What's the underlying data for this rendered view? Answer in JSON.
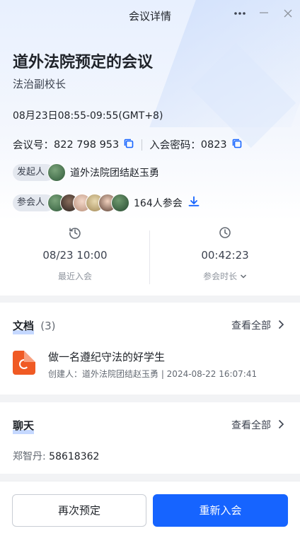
{
  "window": {
    "title": "会议详情"
  },
  "meeting": {
    "title": "道外法院预定的会议",
    "subtitle": "法治副校长",
    "time": "08月23日08:55-09:55(GMT+8)",
    "id_label": "会议号：",
    "id_value": "822 798 953",
    "password_label": "入会密码：",
    "password_value": "0823",
    "organizer_tag": "发起人",
    "organizer_name": "道外法院团结赵玉勇",
    "participants_tag": "参会人",
    "participants_count": "164人参会"
  },
  "stats": {
    "last_join_value": "08/23 10:00",
    "last_join_label": "最近入会",
    "duration_value": "00:42:23",
    "duration_label": "参会时长"
  },
  "docs": {
    "heading": "文档",
    "count": "(3)",
    "view_all": "查看全部",
    "item_title": "做一名遵纪守法的好学生",
    "item_meta": "创建人：道外法院团结赵玉勇 | 2024-08-22 16:07:41"
  },
  "chat": {
    "heading": "聊天",
    "view_all": "查看全部",
    "sender": "郑智丹:",
    "message": " 58618362"
  },
  "buttons": {
    "rebook": "再次预定",
    "rejoin": "重新入会"
  },
  "colors": {
    "accent": "#1664ff",
    "doc_icon": "#f05a24"
  },
  "icons": [
    "more-icon",
    "minimize-icon",
    "close-icon",
    "copy-icon",
    "download-icon",
    "history-icon",
    "clock-icon",
    "chevron-right-icon",
    "chevron-down-icon",
    "slides-file-icon"
  ]
}
